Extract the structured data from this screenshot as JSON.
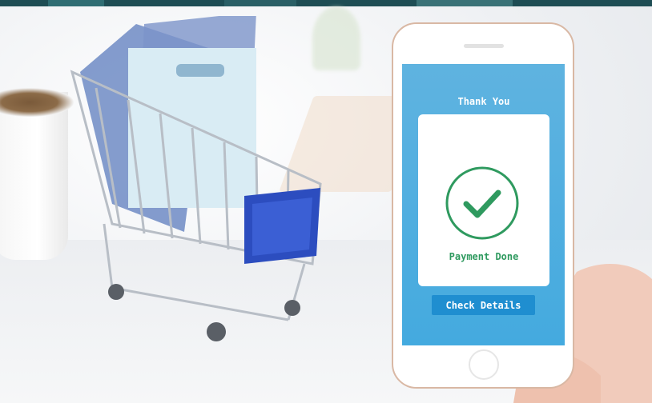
{
  "screen": {
    "title": "Thank You",
    "status": "Payment Done",
    "button_label": "Check Details",
    "icon": "check-circle-icon"
  },
  "colors": {
    "screen_top": "#5fb3e0",
    "screen_bottom": "#44aadf",
    "check": "#2f9a5f",
    "button": "#1f8ed0"
  }
}
